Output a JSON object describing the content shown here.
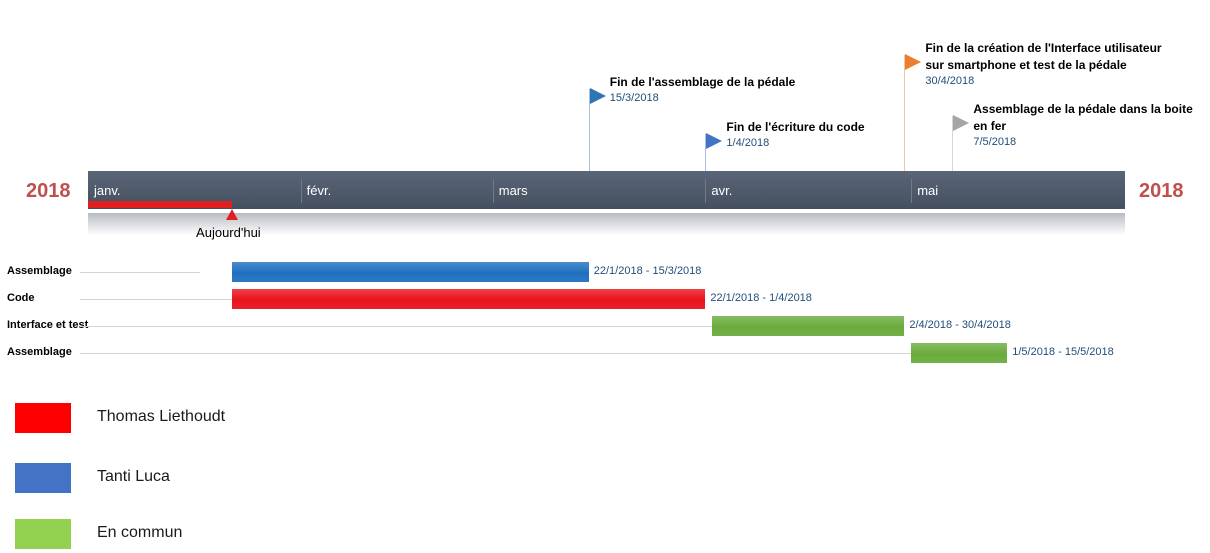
{
  "chart_data": {
    "type": "gantt",
    "years": {
      "left": "2018",
      "right": "2018"
    },
    "months": [
      "janv.",
      "févr.",
      "mars",
      "avr.",
      "mai"
    ],
    "range": {
      "start": "2018-01-01",
      "end": "2018-05-31"
    },
    "today": {
      "label": "Aujourd'hui",
      "date": "2018-01-22"
    },
    "milestones": [
      {
        "title": [
          "Fin de l'assemblage de la pédale"
        ],
        "date_label": "15/3/2018",
        "date": "2018-03-15",
        "color": "#2e75b6",
        "tier": 1
      },
      {
        "title": [
          "Fin de l'écriture du code"
        ],
        "date_label": "1/4/2018",
        "date": "2018-04-01",
        "color": "#4472c4",
        "tier": 2
      },
      {
        "title": [
          "Fin de la création de l'Interface utilisateur",
          "sur smartphone et test de la pédale"
        ],
        "date_label": "30/4/2018",
        "date": "2018-04-30",
        "color": "#ed7d31",
        "tier": 0
      },
      {
        "title": [
          "Assemblage de la pédale dans la boite",
          "en fer"
        ],
        "date_label": "7/5/2018",
        "date": "2018-05-07",
        "color": "#a5a5a5",
        "tier": 3
      }
    ],
    "tasks": [
      {
        "label": "Assemblage",
        "start": "2018-01-22",
        "end": "2018-03-15",
        "range_label": "22/1/2018 - 15/3/2018",
        "color": "#1f6fbf"
      },
      {
        "label": "Code",
        "start": "2018-01-22",
        "end": "2018-04-01",
        "range_label": "22/1/2018 - 1/4/2018",
        "color": "#e8121c"
      },
      {
        "label": "Interface et test",
        "start": "2018-04-02",
        "end": "2018-04-30",
        "range_label": "2/4/2018 - 30/4/2018",
        "color": "#6aab3d"
      },
      {
        "label": "Assemblage",
        "start": "2018-05-01",
        "end": "2018-05-15",
        "range_label": "1/5/2018 - 15/5/2018",
        "color": "#6aab3d"
      }
    ],
    "legend": [
      {
        "label": "Thomas Liethoudt",
        "color": "#ff0000"
      },
      {
        "label": "Tanti Luca",
        "color": "#4472c4"
      },
      {
        "label": "En commun",
        "color": "#92d050"
      }
    ]
  }
}
